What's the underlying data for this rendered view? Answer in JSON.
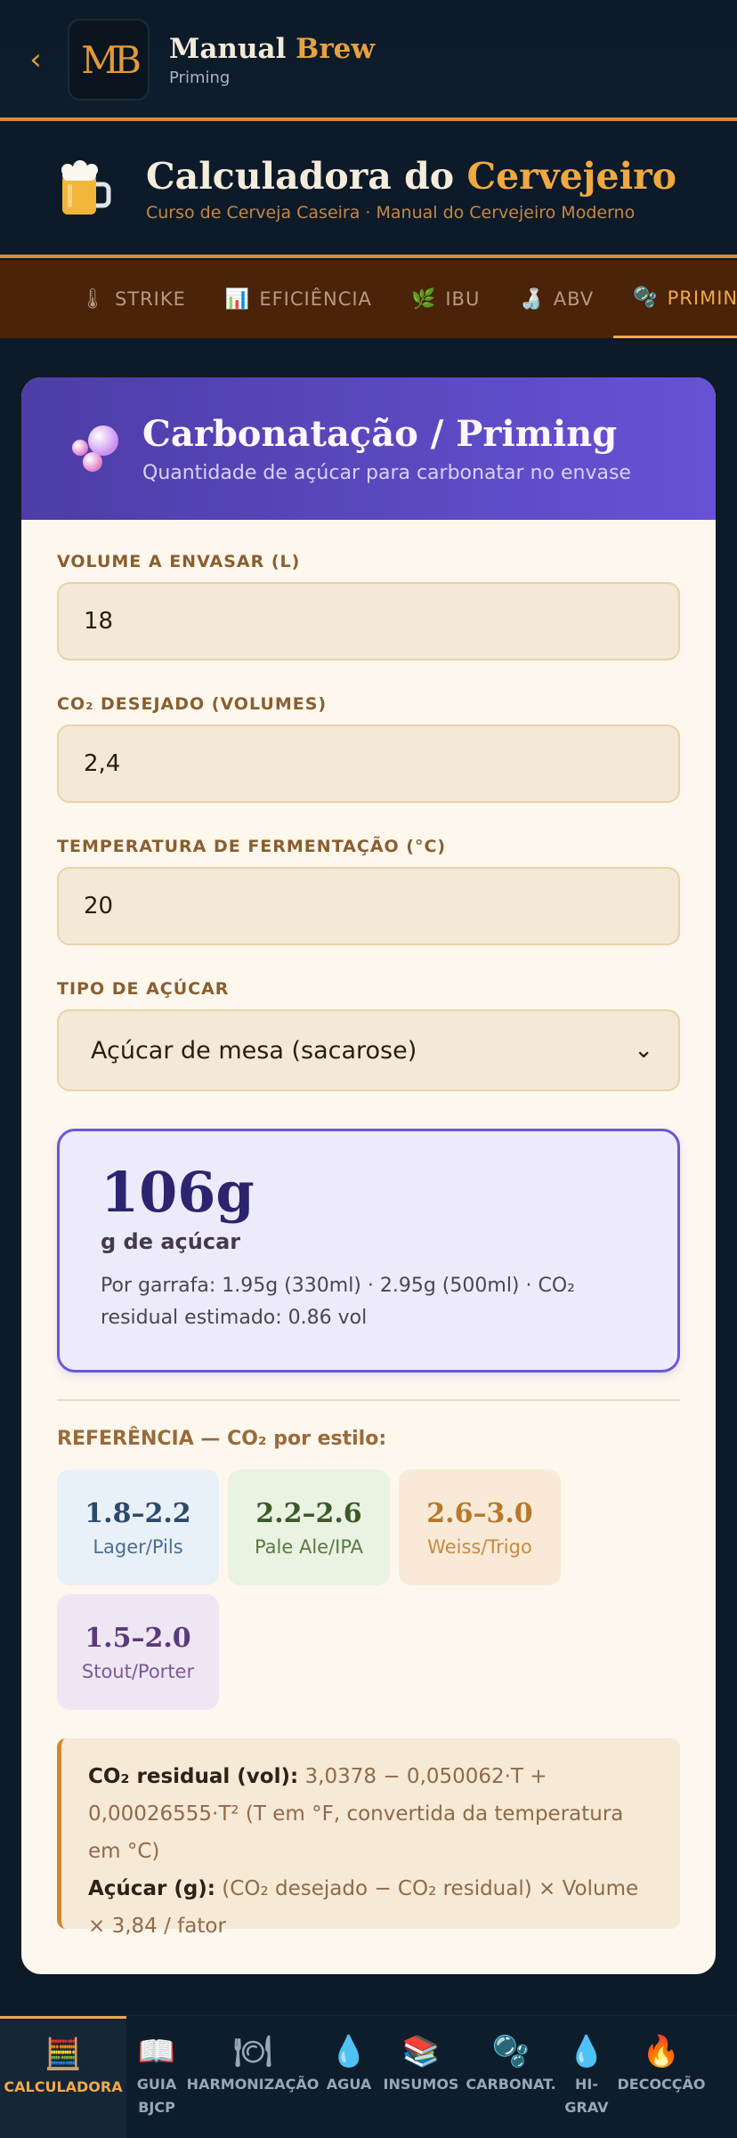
{
  "appbar": {
    "back_icon": "chevron-left-icon",
    "logo_text": "MB",
    "app_name_1": "Manual",
    "app_name_2": "Brew",
    "subtitle": "Priming"
  },
  "hero": {
    "title_1": "Calculadora do",
    "title_2": "Cervejeiro",
    "subtitle": "Curso de Cerveja Caseira · Manual do Cervejeiro Moderno"
  },
  "tabs": [
    {
      "icon": "🌡",
      "label": "STRIKE",
      "active": false
    },
    {
      "icon": "📊",
      "label": "EFICIÊNCIA",
      "active": false
    },
    {
      "icon": "🌿",
      "label": "IBU",
      "active": false
    },
    {
      "icon": "🍶",
      "label": "ABV",
      "active": false
    },
    {
      "icon": "🫧",
      "label": "PRIMING",
      "active": true
    }
  ],
  "card": {
    "title": "Carbonatação / Priming",
    "subtitle": "Quantidade de açúcar para carbonatar no envase",
    "fields": {
      "volume_label": "VOLUME A ENVASAR (L)",
      "volume_value": "18",
      "co2_label": "CO₂ DESEJADO (VOLUMES)",
      "co2_value": "2,4",
      "temp_label": "TEMPERATURA DE FERMENTAÇÃO (°C)",
      "temp_value": "20",
      "sugar_label": "TIPO DE AÇÚCAR",
      "sugar_value": "Açúcar de mesa (sacarose)"
    },
    "result": {
      "value": "106g",
      "unit": "g de açúcar",
      "detail": "Por garrafa: 1.95g (330ml) · 2.95g (500ml) · CO₂ residual estimado: 0.86 vol"
    },
    "reference": {
      "title": "REFERÊNCIA — CO₂ por estilo:",
      "items": [
        {
          "range": "1.8–2.2",
          "style": "Lager/Pils",
          "bg": "#e8f0f8",
          "fg": "#2c4a6e",
          "lbl": "#4a6d90"
        },
        {
          "range": "2.2–2.6",
          "style": "Pale Ale/IPA",
          "bg": "#eaf2e2",
          "fg": "#3a5a28",
          "lbl": "#587a42"
        },
        {
          "range": "2.6–3.0",
          "style": "Weiss/Trigo",
          "bg": "#f8ead6",
          "fg": "#b8782a",
          "lbl": "#c78a44"
        },
        {
          "range": "1.5–2.0",
          "style": "Stout/Porter",
          "bg": "#efe6f4",
          "fg": "#5a3a7a",
          "lbl": "#7a5a98"
        }
      ]
    },
    "formula": {
      "line1_label": "CO₂ residual (vol):",
      "line1_text": " 3,0378 − 0,050062·T + 0,00026555·T² (T em °F, convertida da temperatura em °C)",
      "line2_label": "Açúcar (g):",
      "line2_text": " (CO₂ desejado − CO₂ residual) × Volume × 3,84 / fator"
    }
  },
  "bottom_nav": [
    {
      "icon": "🧮",
      "label": "CALCULADORA",
      "active": true
    },
    {
      "icon": "📖",
      "label": "GUIA BJCP",
      "active": false
    },
    {
      "icon": "🍽",
      "label": "HARMONIZAÇÃO",
      "active": false
    },
    {
      "icon": "💧",
      "label": "AGUA",
      "active": false
    },
    {
      "icon": "📚",
      "label": "INSUMOS",
      "active": false
    },
    {
      "icon": "🫧",
      "label": "CARBONAT.",
      "active": false
    },
    {
      "icon": "💧",
      "label": "HI-GRAV",
      "active": false
    },
    {
      "icon": "🔥",
      "label": "DECOCÇÃO",
      "active": false
    }
  ]
}
